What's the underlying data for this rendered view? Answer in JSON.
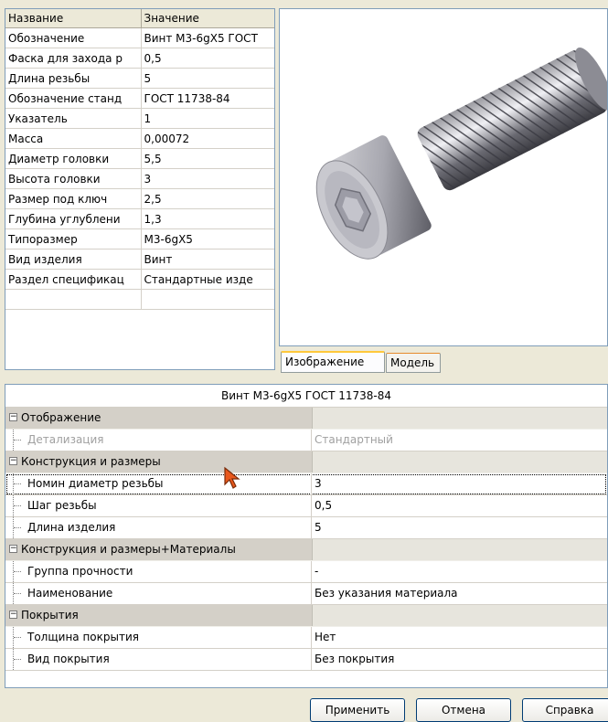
{
  "props_table": {
    "headers": [
      "Название",
      "Значение"
    ],
    "rows": [
      [
        "Обозначение",
        "Винт М3-6gX5 ГОСТ"
      ],
      [
        "Фаска для захода р",
        "0,5"
      ],
      [
        "Длина резьбы",
        "5"
      ],
      [
        "Обозначение станд",
        "ГОСТ 11738-84"
      ],
      [
        "Указатель",
        "1"
      ],
      [
        "Масса",
        "0,00072"
      ],
      [
        "Диаметр головки",
        "5,5"
      ],
      [
        "Высота головки",
        "3"
      ],
      [
        "Размер под ключ",
        "2,5"
      ],
      [
        "Глубина углублени",
        "1,3"
      ],
      [
        "Типоразмер",
        "М3-6gX5"
      ],
      [
        "Вид изделия",
        "Винт"
      ],
      [
        "Раздел спецификац",
        "Стандартные изде"
      ]
    ]
  },
  "tabs": [
    {
      "label": "Изображение",
      "active": true
    },
    {
      "label": "Модель",
      "active": false
    }
  ],
  "grid": {
    "title": "Винт М3-6gX5 ГОСТ 11738-84",
    "rows": [
      {
        "type": "cat",
        "label": "Отображение",
        "value": ""
      },
      {
        "type": "item",
        "label": "Детализация",
        "value": "Стандартный",
        "disabled": true
      },
      {
        "type": "cat",
        "label": "Конструкция и размеры",
        "value": ""
      },
      {
        "type": "item",
        "label": "Номин диаметр резьбы",
        "value": "3",
        "selected": true
      },
      {
        "type": "item",
        "label": "Шаг резьбы",
        "value": "0,5"
      },
      {
        "type": "item",
        "label": "Длина изделия",
        "value": "5"
      },
      {
        "type": "cat",
        "label": "Конструкция и размеры+Материалы",
        "value": ""
      },
      {
        "type": "item",
        "label": "Группа прочности",
        "value": "-"
      },
      {
        "type": "item",
        "label": "Наименование",
        "value": "Без указания материала"
      },
      {
        "type": "cat",
        "label": "Покрытия",
        "value": ""
      },
      {
        "type": "item",
        "label": "Толщина покрытия",
        "value": "Нет"
      },
      {
        "type": "item",
        "label": "Вид покрытия",
        "value": "Без покрытия"
      }
    ]
  },
  "buttons": {
    "apply": "Применить",
    "cancel": "Отмена",
    "help": "Справка"
  },
  "icons": {
    "collapse": "minus-box-icon",
    "cursor": "arrow-cursor-icon"
  },
  "colors": {
    "window_bg": "#ece9d8",
    "category_bg": "#d4d0c8",
    "tab_highlight": "#ffc83c",
    "cursor": "#e8581c"
  }
}
